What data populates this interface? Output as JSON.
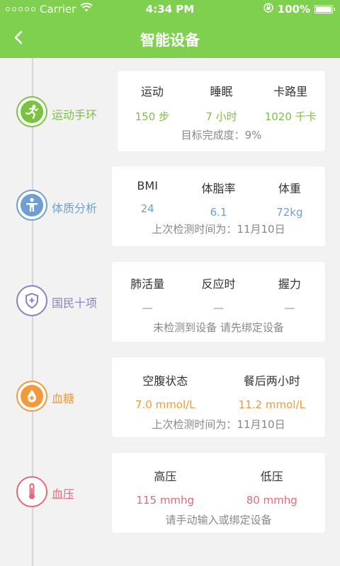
{
  "status_bar": {
    "carrier": "Carrier",
    "time": "4:34 PM",
    "battery": "100%"
  },
  "nav": {
    "title": "智能设备"
  },
  "devices": [
    {
      "label": "运动手环",
      "color": "#7cc241",
      "icon": "running-icon",
      "items": [
        {
          "title": "运动",
          "value": "150 步"
        },
        {
          "title": "睡眠",
          "value": "7 小时"
        },
        {
          "title": "卡路里",
          "value": "1020 千卡"
        }
      ],
      "footer": "目标完成度：9%"
    },
    {
      "label": "体质分析",
      "color": "#6f9fd0",
      "icon": "body-icon",
      "items": [
        {
          "title": "BMI",
          "value": "24"
        },
        {
          "title": "体脂率",
          "value": "6.1"
        },
        {
          "title": "体重",
          "value": "72kg"
        }
      ],
      "footer": "上次检测时间为：11月10日"
    },
    {
      "label": "国民十项",
      "color": "#8e7fc4",
      "icon": "shield-cross-icon",
      "items": [
        {
          "title": "肺活量",
          "value": "—"
        },
        {
          "title": "反应时",
          "value": "—"
        },
        {
          "title": "握力",
          "value": "—"
        }
      ],
      "footer": "未检测到设备 请先绑定设备"
    },
    {
      "label": "血糖",
      "color": "#f29a3b",
      "icon": "blood-drop-icon",
      "items": [
        {
          "title": "空腹状态",
          "value": "7.0 mmol/L"
        },
        {
          "title": "餐后两小时",
          "value": "11.2 mmol/L"
        }
      ],
      "footer": "上次检测时间为：11月10日"
    },
    {
      "label": "血压",
      "color": "#e16a7b",
      "icon": "thermometer-icon",
      "items": [
        {
          "title": "高压",
          "value": "115 mmhg"
        },
        {
          "title": "低压",
          "value": "80 mmhg"
        }
      ],
      "footer": "请手动输入或绑定设备"
    }
  ]
}
